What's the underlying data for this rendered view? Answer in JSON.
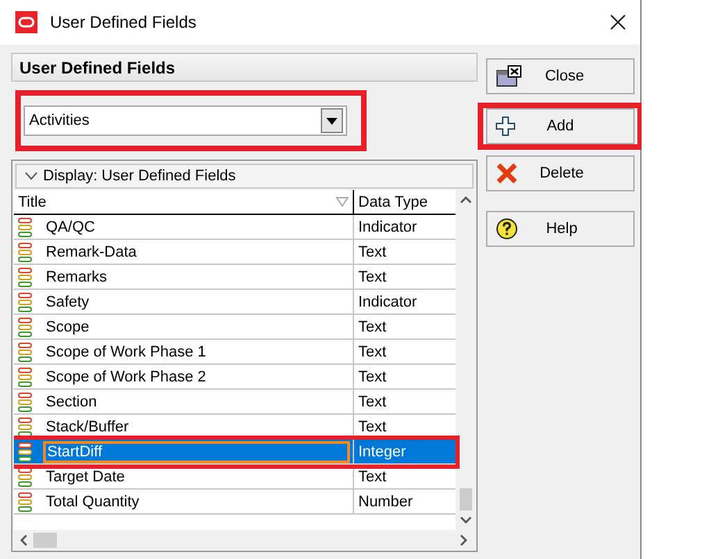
{
  "window": {
    "title": "User Defined Fields"
  },
  "panel": {
    "title": "User Defined Fields"
  },
  "combo": {
    "value": "Activities"
  },
  "group": {
    "label": "Display: User Defined Fields",
    "expanded": true
  },
  "table": {
    "columns": [
      {
        "label": "Title",
        "sortable": true
      },
      {
        "label": "Data Type",
        "sortable": false
      }
    ],
    "rows": [
      {
        "title": "QA/QC",
        "data_type": "Indicator",
        "selected": false
      },
      {
        "title": "Remark-Data",
        "data_type": "Text",
        "selected": false
      },
      {
        "title": "Remarks",
        "data_type": "Text",
        "selected": false
      },
      {
        "title": "Safety",
        "data_type": "Indicator",
        "selected": false
      },
      {
        "title": "Scope",
        "data_type": "Text",
        "selected": false
      },
      {
        "title": "Scope of Work Phase 1",
        "data_type": "Text",
        "selected": false
      },
      {
        "title": "Scope of Work Phase 2",
        "data_type": "Text",
        "selected": false
      },
      {
        "title": "Section",
        "data_type": "Text",
        "selected": false
      },
      {
        "title": "Stack/Buffer",
        "data_type": "Text",
        "selected": false
      },
      {
        "title": "StartDiff",
        "data_type": "Integer",
        "selected": true
      },
      {
        "title": "Target Date",
        "data_type": "Text",
        "selected": false
      },
      {
        "title": "Total Quantity",
        "data_type": "Number",
        "selected": false
      }
    ]
  },
  "buttons": [
    {
      "label": "Close",
      "kind": "close",
      "highlighted": false
    },
    {
      "label": "Add",
      "kind": "add",
      "highlighted": true
    },
    {
      "label": "Delete",
      "kind": "delete",
      "highlighted": false
    },
    {
      "label": "Help",
      "kind": "help",
      "highlighted": false
    }
  ]
}
